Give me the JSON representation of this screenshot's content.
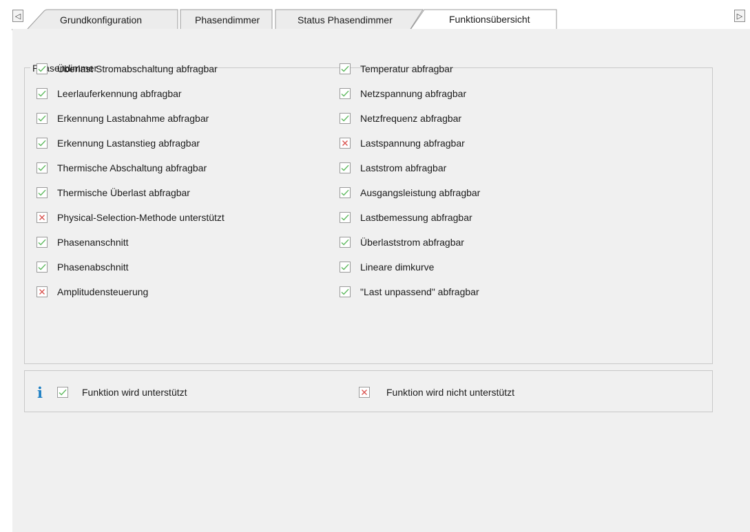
{
  "tabs": [
    {
      "label": "Grundkonfiguration",
      "active": false
    },
    {
      "label": "Phasendimmer",
      "active": false
    },
    {
      "label": "Status Phasendimmer",
      "active": false
    },
    {
      "label": "Funktionsübersicht",
      "active": true
    }
  ],
  "nav": {
    "scroll_left_icon": "triangle-left-icon",
    "scroll_right_icon": "triangle-right-icon"
  },
  "group": {
    "title": "Phasendimmer",
    "left_column": [
      {
        "label": "Überlast Stromabschaltung abfragbar",
        "supported": true
      },
      {
        "label": "Leerlauferkennung abfragbar",
        "supported": true
      },
      {
        "label": "Erkennung Lastabnahme abfragbar",
        "supported": true
      },
      {
        "label": "Erkennung Lastanstieg abfragbar",
        "supported": true
      },
      {
        "label": "Thermische Abschaltung abfragbar",
        "supported": true
      },
      {
        "label": "Thermische Überlast abfragbar",
        "supported": true
      },
      {
        "label": "Physical-Selection-Methode unterstützt",
        "supported": false
      },
      {
        "label": "Phasenanschnitt",
        "supported": true
      },
      {
        "label": "Phasenabschnitt",
        "supported": true
      },
      {
        "label": "Amplitudensteuerung",
        "supported": false
      }
    ],
    "right_column": [
      {
        "label": "Temperatur abfragbar",
        "supported": true
      },
      {
        "label": "Netzspannung abfragbar",
        "supported": true
      },
      {
        "label": "Netzfrequenz abfragbar",
        "supported": true
      },
      {
        "label": "Lastspannung abfragbar",
        "supported": false
      },
      {
        "label": "Laststrom abfragbar",
        "supported": true
      },
      {
        "label": "Ausgangsleistung abfragbar",
        "supported": true
      },
      {
        "label": "Lastbemessung abfragbar",
        "supported": true
      },
      {
        "label": "Überlaststrom abfragbar",
        "supported": true
      },
      {
        "label": "Lineare dimkurve",
        "supported": true
      },
      {
        "label": "\"Last unpassend\" abfragbar",
        "supported": true
      }
    ]
  },
  "legend": {
    "info_icon": "info-icon",
    "supported_label": "Funktion wird unterstützt",
    "unsupported_label": "Funktion wird nicht unterstützt"
  },
  "colors": {
    "check": "#5cb85c",
    "cross": "#d9534f",
    "info": "#1d7fc4",
    "panel": "#f0f0f0"
  }
}
